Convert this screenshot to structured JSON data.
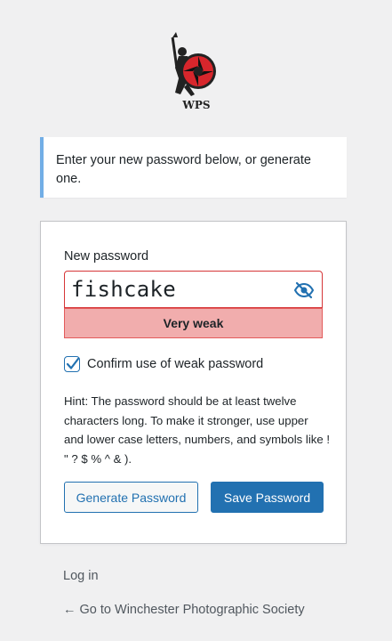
{
  "site": {
    "logo_text": "WPS",
    "name": "Winchester Photographic Society"
  },
  "message": {
    "text": "Enter your new password below, or generate one."
  },
  "form": {
    "new_password_label": "New password",
    "password_value": "fishcake",
    "strength_text": "Very weak",
    "confirm_weak_label": "Confirm use of weak password",
    "confirm_weak_checked": true,
    "hint": "Hint: The password should be at least twelve characters long. To make it stronger, use upper and lower case letters, numbers, and symbols like ! \" ? $ % ^ & ).",
    "generate_button": "Generate Password",
    "save_button": "Save Password"
  },
  "nav": {
    "login_link": "Log in",
    "back_link": "← Go to Winchester Photographic Society"
  },
  "icons": {
    "visibility_toggle": "eye-slash-icon",
    "checkbox_mark": "checkmark-icon"
  },
  "colors": {
    "background": "#f0f0f1",
    "accent": "#2271b1",
    "notice_border": "#72aee6",
    "error_border": "#d63638",
    "strength_bg": "#f1adad",
    "logo_red": "#d7262c"
  }
}
